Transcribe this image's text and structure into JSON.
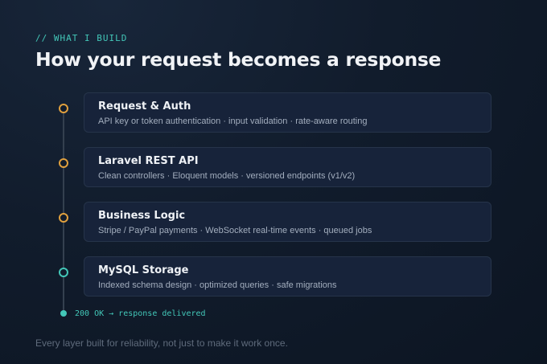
{
  "eyebrow": "// WHAT I BUILD",
  "title": "How your request becomes a response",
  "steps": [
    {
      "title": "Request & Auth",
      "subtitle": "API key or token authentication · input validation · rate-aware routing",
      "node_color": "#e0a03e"
    },
    {
      "title": "Laravel REST API",
      "subtitle": "Clean controllers · Eloquent models · versioned endpoints (v1/v2)",
      "node_color": "#e0a03e"
    },
    {
      "title": "Business Logic",
      "subtitle": "Stripe / PayPal payments · WebSocket real-time events · queued jobs",
      "node_color": "#e0a03e"
    },
    {
      "title": "MySQL Storage",
      "subtitle": "Indexed schema design · optimized queries · safe migrations",
      "node_color": "#43c7b8"
    }
  ],
  "status": "200 OK → response delivered",
  "footer": "Every layer built for reliability, not just to make it work once.",
  "colors": {
    "accent": "#43c7b8",
    "node": "#e0a03e",
    "card": "#17233a",
    "background": "#111c2c"
  }
}
